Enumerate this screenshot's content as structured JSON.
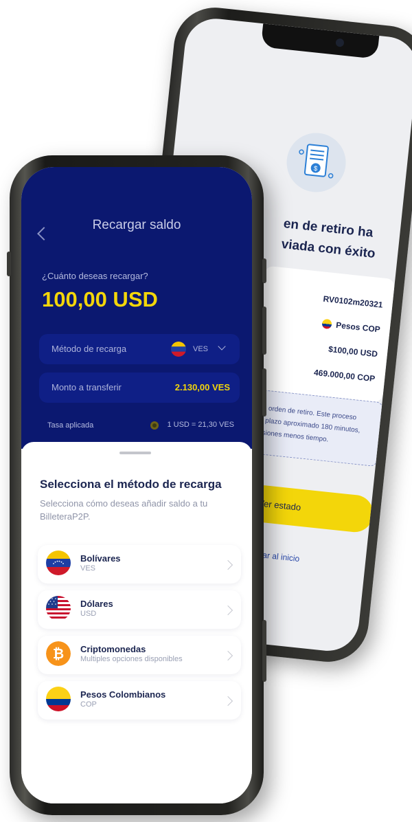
{
  "back_screen": {
    "success_title_line1": "en de retiro ha",
    "success_title_line2": "viada con éxito",
    "reference": "RV0102m20321",
    "currency": "Pesos COP",
    "amount_usd": "$100,00 USD",
    "amount_cop": "469.000,00 COP",
    "notice_lines": [
      "tu orden de retiro. Este proceso",
      "n plazo aproximado 180 minutos,",
      "asiones menos tiempo."
    ],
    "status_button": "Ver estado",
    "home_link": "egresar al inicio"
  },
  "front_screen": {
    "title": "Recargar saldo",
    "question": "¿Cuánto deseas recargar?",
    "amount": "100,00 USD",
    "method_label": "Método de recarga",
    "method_currency": "VES",
    "transfer_label": "Monto a transferir",
    "transfer_value": "2.130,00 VES",
    "rate_label": "Tasa aplicada",
    "rate_value": "1 USD = 21,30 VES",
    "sheet": {
      "title": "Selecciona el método de recarga",
      "subtitle": "Selecciona cómo deseas añadir saldo a tu BilleteraP2P.",
      "methods": [
        {
          "name": "Bolívares",
          "code": "VES",
          "icon": "venezuela-flag-icon"
        },
        {
          "name": "Dólares",
          "code": "USD",
          "icon": "usa-flag-icon"
        },
        {
          "name": "Criptomonedas",
          "code": "Multiples opciones disponibles",
          "icon": "bitcoin-icon"
        },
        {
          "name": "Pesos Colombianos",
          "code": "COP",
          "icon": "colombia-flag-icon"
        }
      ]
    }
  },
  "colors": {
    "navy": "#0b1870",
    "accent_yellow": "#f3d60a",
    "text_dark": "#1b2550"
  }
}
